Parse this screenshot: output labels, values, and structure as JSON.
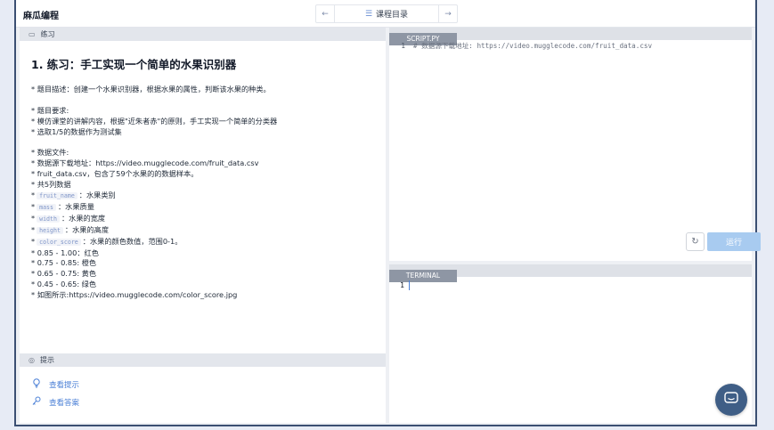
{
  "header": {
    "brand": "麻瓜编程",
    "prev_icon": "←",
    "next_icon": "→",
    "catalog_icon": "list-icon",
    "catalog_label": "课程目录"
  },
  "exercise": {
    "section_label": "练习",
    "title": "1. 练习：手工实现一个简单的水果识别器",
    "lines": [
      "* 题目描述：创建一个水果识别器，根据水果的属性，判断该水果的种类。",
      "",
      "* 题目要求:",
      "* 模仿课堂的讲解内容，根据\"近朱者赤\"的原则，手工实现一个简单的分类器",
      "* 选取1/5的数据作为测试集",
      "",
      "* 数据文件:",
      "* 数据源下载地址：https://video.mugglecode.com/fruit_data.csv",
      "* fruit_data.csv，包含了59个水果的的数据样本。",
      "* 共5列数据"
    ],
    "columns": [
      {
        "code": "fruit_name",
        "desc": "：水果类别"
      },
      {
        "code": "mass",
        "desc": "：水果质量"
      },
      {
        "code": "width",
        "desc": "：水果的宽度"
      },
      {
        "code": "height",
        "desc": "：水果的高度"
      },
      {
        "code": "color_score",
        "desc": "：水果的颜色数值，范围0-1。"
      }
    ],
    "colors": [
      "* 0.85 - 1.00：红色",
      "* 0.75 - 0.85: 橙色",
      "* 0.65 - 0.75: 黄色",
      "* 0.45 - 0.65: 绿色",
      "* 如图所示:https://video.mugglecode.com/color_score.jpg"
    ]
  },
  "hints": {
    "section_label": "提示",
    "view_hint": "查看提示",
    "view_answer": "查看答案"
  },
  "editor": {
    "tab_label": "SCRIPT.PY",
    "lines": [
      {
        "num": "1",
        "text": "# 数据源下载地址: https://video.mugglecode.com/fruit_data.csv"
      }
    ],
    "reset_icon": "refresh-icon",
    "run_label": "运行"
  },
  "terminal": {
    "tab_label": "TERMINAL",
    "line_num": "1"
  },
  "colors": {
    "frame_border": "#3b4f72",
    "link": "#4a7fd6",
    "run_button": "#a8cbf0",
    "tab": "#8e96a4",
    "chat_button": "#3f5e86"
  }
}
